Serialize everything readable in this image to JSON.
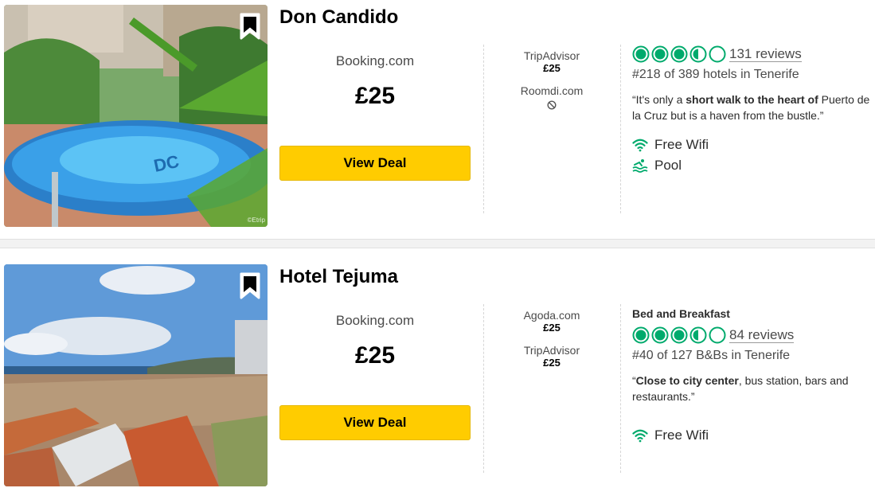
{
  "colors": {
    "deal_button": "#ffcc00",
    "rating_green": "#00aa6c"
  },
  "hotels": [
    {
      "name": "Don Candido",
      "image_icon": "bookmark-icon",
      "photo_credit": "©Etrip",
      "main_provider": "Booking.com",
      "main_price": "£25",
      "deal_label": "View Deal",
      "other_offers": [
        {
          "provider": "TripAdvisor",
          "price": "£25"
        },
        {
          "provider": "Roomdi.com",
          "price": null,
          "unavailable_icon": "no-availability-icon"
        }
      ],
      "accommodation_type": "",
      "rating": 3.5,
      "reviews": "131 reviews",
      "rank": "#218 of 389 hotels in Tenerife",
      "quote": {
        "open": "“It's only a ",
        "bold": "short walk to the heart of",
        "close": " Puerto de la Cruz but is a haven from the bustle.”"
      },
      "amenities": [
        {
          "icon": "wifi-icon",
          "label": "Free Wifi"
        },
        {
          "icon": "pool-icon",
          "label": "Pool"
        }
      ]
    },
    {
      "name": "Hotel Tejuma",
      "image_icon": "bookmark-icon",
      "main_provider": "Booking.com",
      "main_price": "£25",
      "deal_label": "View Deal",
      "other_offers": [
        {
          "provider": "Agoda.com",
          "price": "£25"
        },
        {
          "provider": "TripAdvisor",
          "price": "£25"
        }
      ],
      "accommodation_type": "Bed and Breakfast",
      "rating": 3.5,
      "reviews": "84 reviews",
      "rank": "#40 of 127 B&Bs in Tenerife",
      "quote": {
        "open": "“",
        "bold": "Close to city center",
        "close": ", bus station, bars and restaurants.”"
      },
      "amenities": [
        {
          "icon": "wifi-icon",
          "label": "Free Wifi"
        }
      ]
    }
  ]
}
